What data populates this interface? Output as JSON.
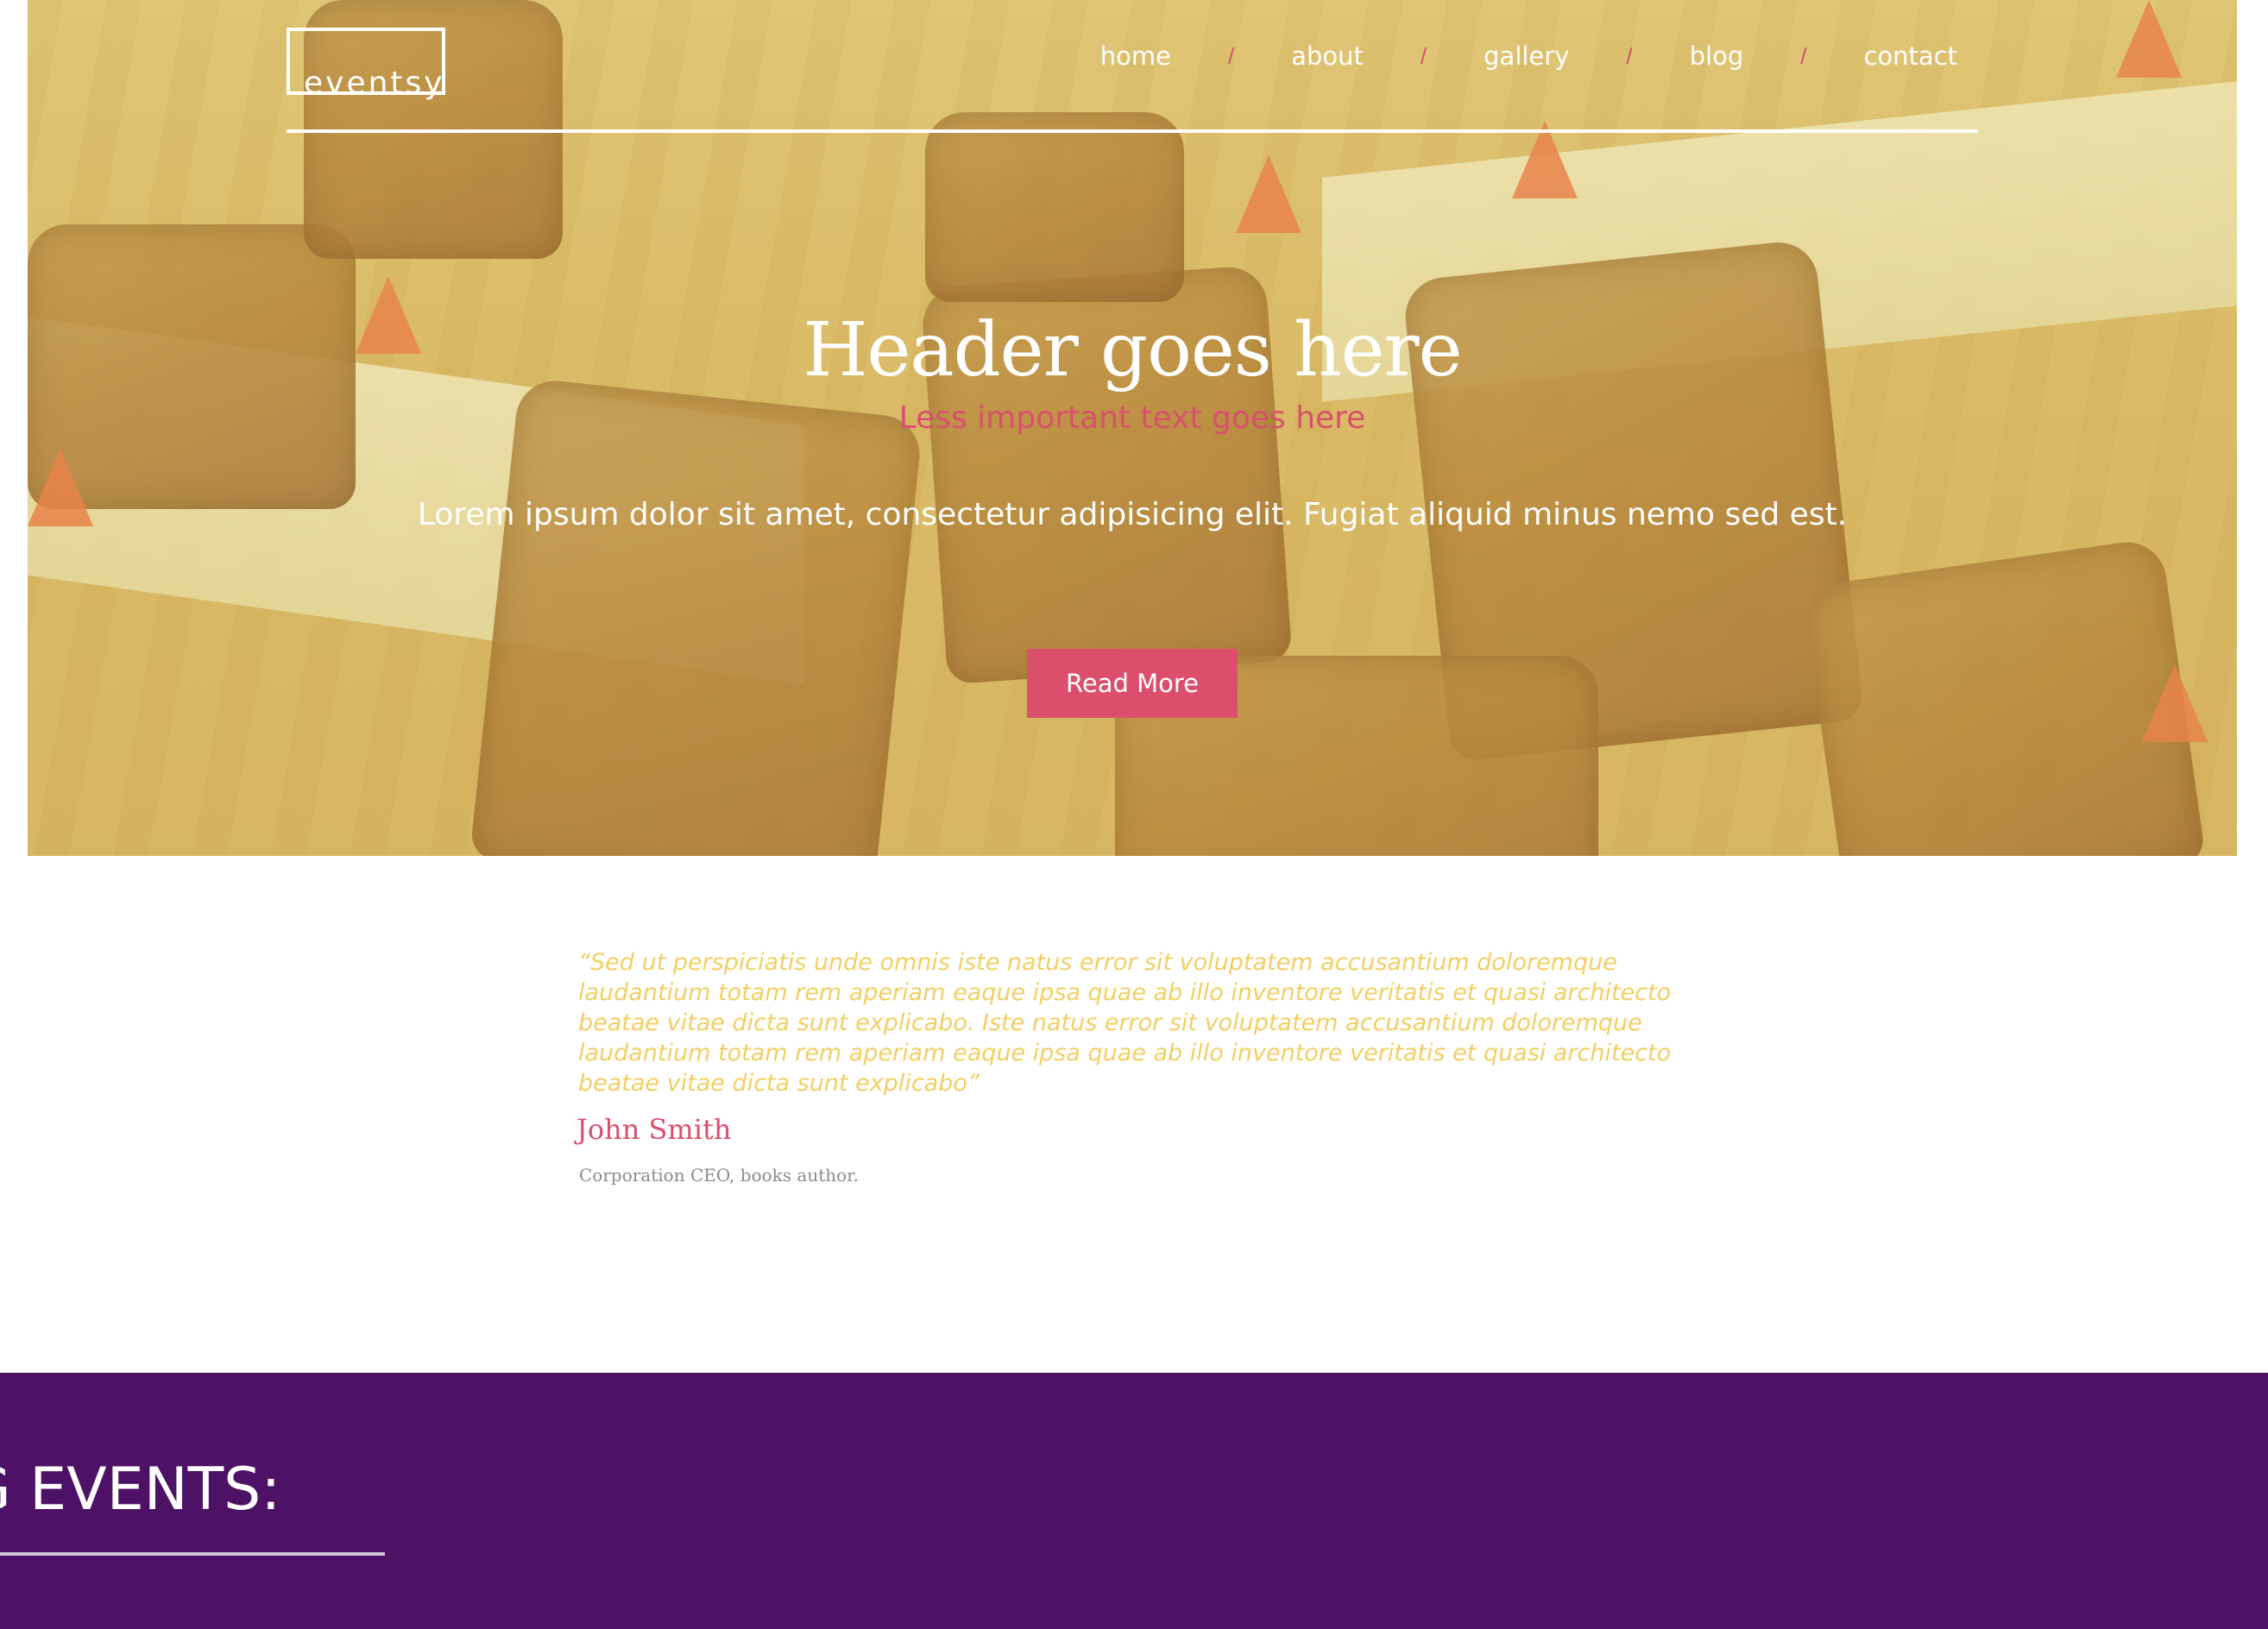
{
  "header": {
    "logo_text": "eventsy",
    "nav": [
      {
        "label": "home"
      },
      {
        "label": "about"
      },
      {
        "label": "gallery"
      },
      {
        "label": "blog"
      },
      {
        "label": "contact"
      }
    ],
    "separator": "/"
  },
  "hero": {
    "title": "Header goes here",
    "subtitle": "Less important text goes here",
    "body": "Lorem ipsum dolor sit amet, consectetur adipisicing elit. Fugiat aliquid minus nemo sed est.",
    "button_label": "Read More"
  },
  "testimonial": {
    "quote": "“Sed ut perspiciatis unde omnis iste natus error sit voluptatem accusantium doloremque laudantium totam rem aperiam eaque ipsa quae ab illo inventore veritatis et quasi architecto beatae vitae dicta sunt explicabo. Iste natus error sit voluptatem accusantium doloremque laudantium totam rem aperiam eaque ipsa quae ab illo inventore veritatis et quasi architecto beatae vitae dicta sunt explicabo”",
    "author": "John Smith",
    "role": "Corporation CEO, books author."
  },
  "events": {
    "title": "G EVENTS:"
  },
  "colors": {
    "accent": "#db4f6d",
    "quote": "#f2cf63",
    "events_bg": "#4d1266"
  }
}
